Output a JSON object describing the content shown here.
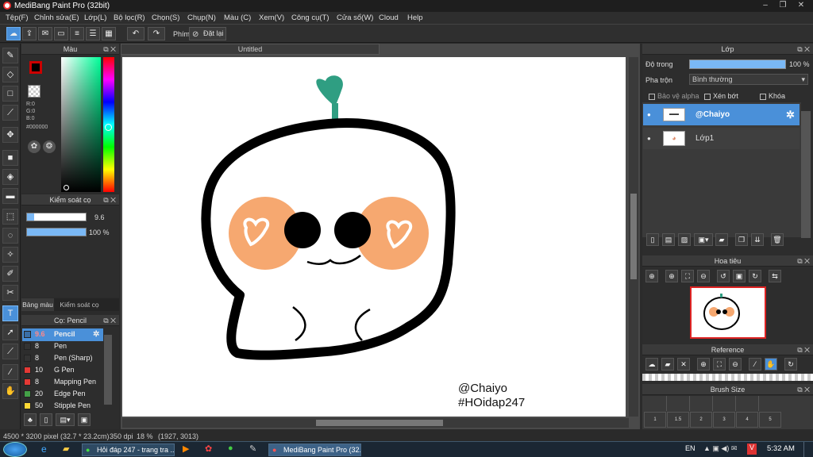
{
  "window": {
    "title": "MediBang Paint Pro (32bit)"
  },
  "menu": [
    "Tệp(F)",
    "Chỉnh sửa(E)",
    "Lớp(L)",
    "Bộ lọc(R)",
    "Chọn(S)",
    "Chụp(N)",
    "Màu (C)",
    "Xem(V)",
    "Công cụ(T)",
    "Cửa sổ(W)",
    "Cloud",
    "Help"
  ],
  "toolbar": {
    "antialias_label": "Phím",
    "reset_label": "Đặt lại"
  },
  "color_panel": {
    "title": "Màu",
    "r": "R:0",
    "g": "G:0",
    "b": "B:0",
    "hex": "#000000",
    "primary": "#000000",
    "secondary": "#ffffff"
  },
  "brush_control": {
    "title": "Kiểm soát cọ",
    "size": "9.6",
    "opacity": "100 %",
    "size_fraction": 0.12,
    "opacity_fraction": 1.0
  },
  "palette_tabs": [
    "Bảng màu",
    "Kiểm soát cọ"
  ],
  "brush_panel": {
    "title": "Cọ: Pencil",
    "brushes": [
      {
        "size": "9.6",
        "name": "Pencil",
        "color": "#3a6ea5"
      },
      {
        "size": "8",
        "name": "Pen",
        "color": "#333333"
      },
      {
        "size": "8",
        "name": "Pen (Sharp)",
        "color": "#333333"
      },
      {
        "size": "10",
        "name": "G Pen",
        "color": "#e53935"
      },
      {
        "size": "8",
        "name": "Mapping Pen",
        "color": "#e53935"
      },
      {
        "size": "20",
        "name": "Edge Pen",
        "color": "#43a047"
      },
      {
        "size": "50",
        "name": "Stipple Pen",
        "color": "#fdd835"
      }
    ]
  },
  "document": {
    "tab": "Untitled",
    "watermark_line1": "@Chaiyo",
    "watermark_line2": "#HOidap247"
  },
  "layer_panel": {
    "title": "Lớp",
    "opacity_label": "Độ trong",
    "opacity_value": "100 %",
    "blend_label": "Pha trộn",
    "blend_value": "Bình thường",
    "protect_alpha": "Bảo vệ alpha",
    "clipping": "Xén bớt",
    "lock": "Khóa",
    "layers": [
      "@Chaiyo",
      "Lớp1"
    ]
  },
  "navigator": {
    "title": "Hoa tiêu"
  },
  "reference": {
    "title": "Reference"
  },
  "brush_size": {
    "title": "Brush Size",
    "labels": [
      "1",
      "1.5",
      "2",
      "3",
      "4",
      "5"
    ]
  },
  "status": {
    "size": "4500 * 3200 pixel",
    "cm": "(32.7 * 23.2cm)",
    "dpi": "350 dpi",
    "zoom": "18 %",
    "coords": "(1927, 3013)"
  },
  "taskbar": {
    "task1": "Hỏi đáp 247 - trang tra ...",
    "task2": "MediBang Paint Pro (32...",
    "lang": "EN",
    "time": "5:32 AM"
  }
}
